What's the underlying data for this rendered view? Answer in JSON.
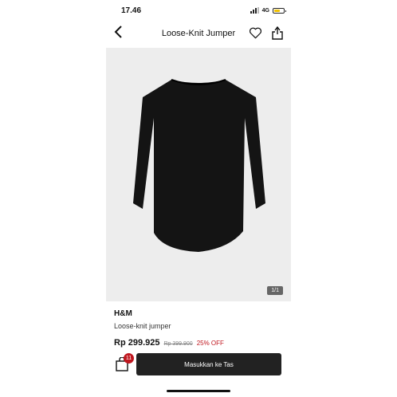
{
  "status_bar": {
    "time": "17.46",
    "network": "4G",
    "battery_level": 0.55
  },
  "nav": {
    "title": "Loose-Knit Jumper",
    "icons": [
      "chevron-left-icon",
      "heart-icon",
      "share-icon"
    ]
  },
  "gallery": {
    "counter": "1/1"
  },
  "product": {
    "brand": "H&M",
    "name": "Loose-knit jumper",
    "price": "Rp 299.925",
    "original_price": "Rp 399.900",
    "discount": "25% OFF"
  },
  "cart": {
    "count": "11",
    "add_label": "Masukkan ke Tas"
  },
  "colors": {
    "accent": "#c0171f",
    "button": "#222222",
    "image_bg": "#ededed",
    "garment": "#141414"
  }
}
